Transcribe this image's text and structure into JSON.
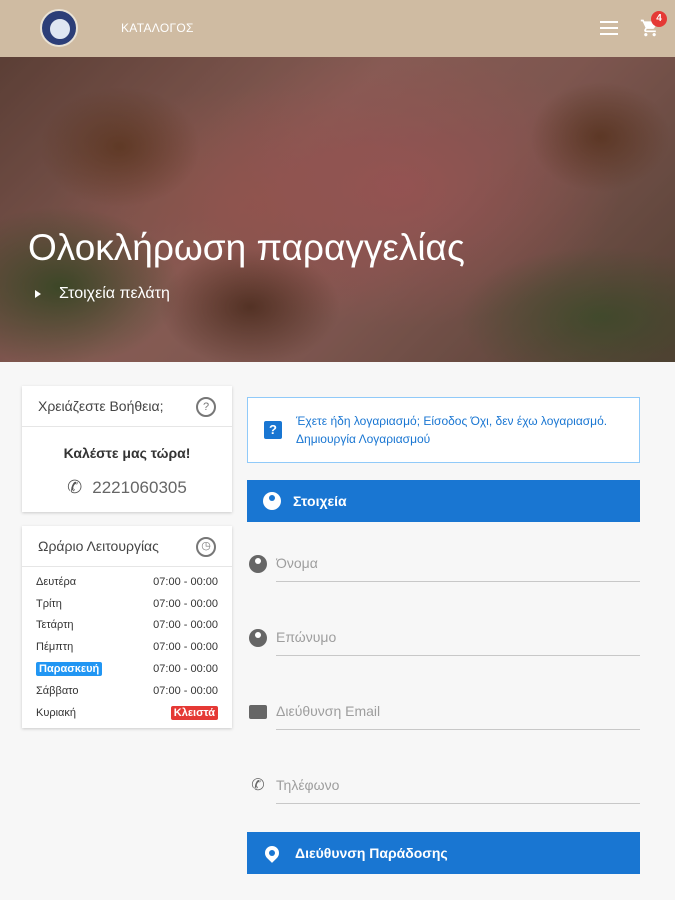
{
  "topbar": {
    "catalog_label": "ΚΑΤΑΛΟΓΟΣ",
    "cart_count": "4",
    "bg_color": "#cfbba2"
  },
  "hero": {
    "title": "Ολοκλήρωση παραγγελίας",
    "breadcrumb": "Στοιχεία πελάτη"
  },
  "help": {
    "title": "Χρειάζεστε Βοήθεια;",
    "call_now": "Καλέστε μας τώρα!",
    "phone": "2221060305"
  },
  "hours": {
    "title": "Ωράριο Λειτουργίας",
    "rows": [
      {
        "day": "Δευτέρα",
        "time": "07:00 - 00:00"
      },
      {
        "day": "Τρίτη",
        "time": "07:00 - 00:00"
      },
      {
        "day": "Τετάρτη",
        "time": "07:00 - 00:00"
      },
      {
        "day": "Πέμπτη",
        "time": "07:00 - 00:00"
      },
      {
        "day": "Παρασκευή",
        "time": "07:00 - 00:00"
      },
      {
        "day": "Σάββατο",
        "time": "07:00 - 00:00"
      },
      {
        "day": "Κυριακή",
        "time": "Κλειστά"
      }
    ]
  },
  "login": {
    "text": "Έχετε ήδη λογαριασμό; Είσοδος     Όχι, δεν έχω λογαριασμό. Δημιουργία Λογαριασμού"
  },
  "form": {
    "section_details": "Στοιχεία",
    "first_name_placeholder": "Όνομα",
    "last_name_placeholder": "Επώνυμο",
    "email_placeholder": "Διεύθυνση Email",
    "phone_placeholder": "Τηλέφωνο",
    "section_address": "Διεύθυνση Παράδοσης"
  },
  "colors": {
    "accent": "#1976d2",
    "today_highlight": "#2196f3",
    "closed": "#e53935"
  }
}
